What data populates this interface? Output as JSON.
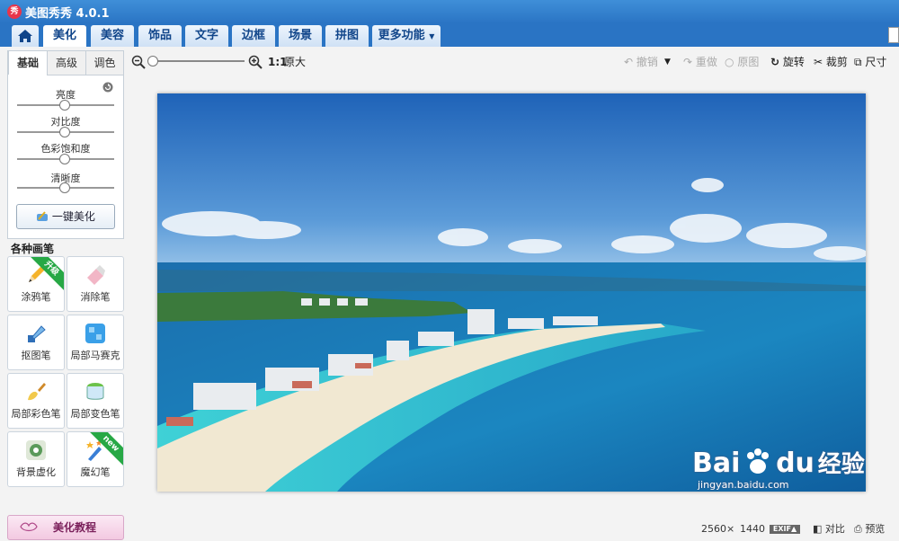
{
  "window": {
    "title": "美图秀秀 4.0.1",
    "logo_text": "秀"
  },
  "nav": {
    "tabs": [
      "美化",
      "美容",
      "饰品",
      "文字",
      "边框",
      "场景",
      "拼图",
      "更多功能"
    ],
    "active": "美化"
  },
  "left_panel": {
    "subtabs": [
      "基础",
      "高级",
      "调色"
    ],
    "sliders": [
      "亮度",
      "对比度",
      "色彩饱和度",
      "清晰度"
    ],
    "oneclick_label": "一键美化"
  },
  "brushes": {
    "title": "各种画笔",
    "items": [
      {
        "label": "涂鸦笔",
        "badge": "升级",
        "icon": "pencil-icon"
      },
      {
        "label": "消除笔",
        "badge": "",
        "icon": "eraser-icon"
      },
      {
        "label": "抠图笔",
        "badge": "",
        "icon": "pen-nib-icon"
      },
      {
        "label": "局部马赛克",
        "badge": "",
        "icon": "mosaic-icon"
      },
      {
        "label": "局部彩色笔",
        "badge": "",
        "icon": "paint-brush-icon"
      },
      {
        "label": "局部变色笔",
        "badge": "",
        "icon": "paint-bucket-icon"
      },
      {
        "label": "背景虚化",
        "badge": "",
        "icon": "blur-icon"
      },
      {
        "label": "魔幻笔",
        "badge": "new",
        "icon": "magic-wand-icon"
      }
    ]
  },
  "tutorial_label": "美化教程",
  "toolbar": {
    "zoom_original": "原大",
    "ratio": "1:1",
    "undo": "撤销",
    "redo": "重做",
    "original": "原图",
    "rotate": "旋转",
    "crop": "裁剪",
    "size": "尺寸"
  },
  "image": {
    "width": "2560",
    "times": "×",
    "height": "1440"
  },
  "statusbar": {
    "exif": "EXIF▲",
    "compare": "对比",
    "preview": "预览"
  },
  "watermark": {
    "brand": "Bai",
    "brand_tail": "du",
    "text": "经验",
    "url": "jingyan.baidu.com"
  },
  "colors": {
    "titlebar": "#2a74c4",
    "accent": "#10458a",
    "badge_green": "#27a845"
  }
}
